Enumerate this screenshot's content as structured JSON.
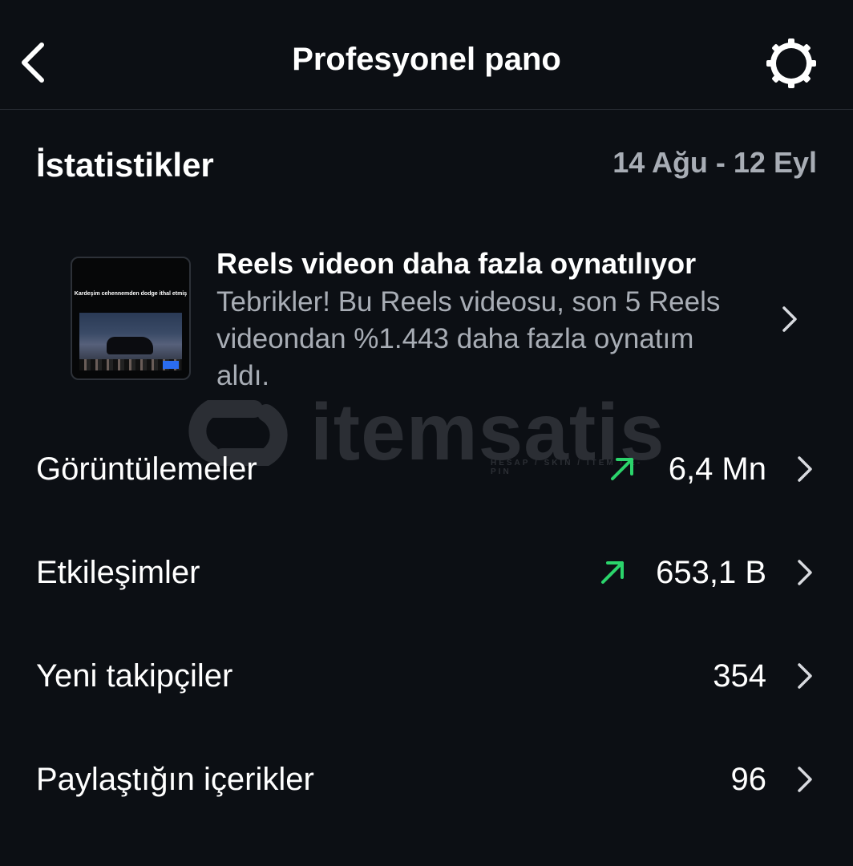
{
  "header": {
    "title": "Profesyonel pano",
    "back_icon": "chevron-left-icon",
    "settings_icon": "gear-icon"
  },
  "stats": {
    "title": "İstatistikler",
    "date_range": "14 Ağu - 12 Eyl"
  },
  "insight": {
    "thumbnail_caption": "Kardeşim cehennemden dodge ithal etmiş",
    "title": "Reels videon daha fazla oynatılıyor",
    "body": "Tebrikler! Bu Reels videosu, son 5 Reels videondan %1.443 daha fazla oynatım aldı."
  },
  "metrics": [
    {
      "label": "Görüntülemeler",
      "value": "6,4 Mn",
      "trend": "up"
    },
    {
      "label": "Etkileşimler",
      "value": "653,1 B",
      "trend": "up"
    },
    {
      "label": "Yeni takipçiler",
      "value": "354",
      "trend": ""
    },
    {
      "label": "Paylaştığın içerikler",
      "value": "96",
      "trend": ""
    }
  ],
  "watermark": {
    "brand": "itemsatis",
    "tagline": "HESAP / SKIN / ITEM / E-PIN"
  },
  "colors": {
    "background": "#0c0f14",
    "secondary_text": "#a8adb5",
    "trend_up": "#2bd46b"
  }
}
